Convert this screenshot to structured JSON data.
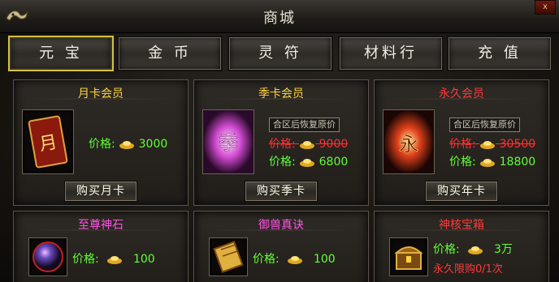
{
  "window": {
    "title": "商城",
    "close_label": "x"
  },
  "tabs": [
    {
      "label": "元 宝",
      "active": true
    },
    {
      "label": "金 币",
      "active": false
    },
    {
      "label": "灵 符",
      "active": false
    },
    {
      "label": "材料行",
      "active": false
    },
    {
      "label": "充 值",
      "active": false
    }
  ],
  "items": {
    "monthly": {
      "title": "月卡会员",
      "icon_glyph": "月",
      "price_label": "价格:",
      "price": "3000",
      "buy_label": "购买月卡"
    },
    "quarterly": {
      "title": "季卡会员",
      "icon_glyph": "季",
      "restore_label": "合区后恢复原价",
      "old_price_label": "价格:",
      "old_price": "9000",
      "price_label": "价格:",
      "price": "6800",
      "buy_label": "购买季卡"
    },
    "permanent": {
      "title": "永久会员",
      "icon_glyph": "永",
      "restore_label": "合区后恢复原价",
      "old_price_label": "价格:",
      "old_price": "30500",
      "price_label": "价格:",
      "price": "18800",
      "buy_label": "购买年卡"
    },
    "stone": {
      "title": "至尊神石",
      "price_label": "价格:",
      "price": "100"
    },
    "scroll": {
      "title": "御兽真诀",
      "price_label": "价格:",
      "price": "100"
    },
    "chest": {
      "title": "神核宝箱",
      "price_label": "价格:",
      "price": "3万",
      "limit_label": "永久限购0/1次"
    }
  },
  "colors": {
    "accent_gold": "#ffd23a",
    "price_green": "#62ff38",
    "warn_red": "#ff3a3a",
    "magenta": "#ff54e5"
  },
  "icons": [
    "dragon-emblem-icon",
    "close-icon",
    "gold-ingot-icon",
    "month-card-icon",
    "season-card-icon",
    "permanent-card-icon",
    "crystal-orb-icon",
    "scroll-icon",
    "treasure-chest-icon"
  ]
}
